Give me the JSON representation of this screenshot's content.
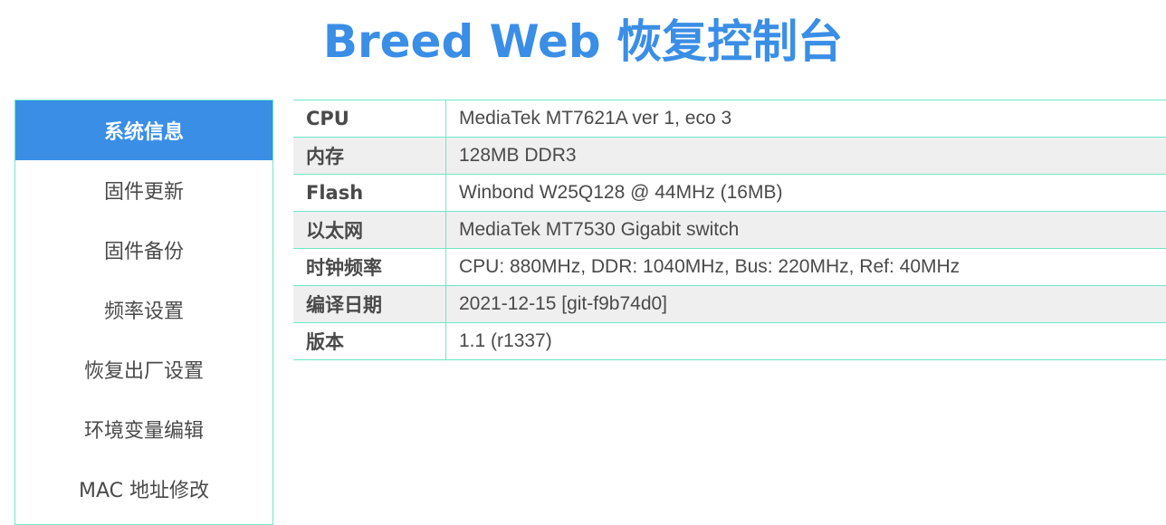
{
  "header": {
    "title": "Breed Web 恢复控制台"
  },
  "sidebar": {
    "items": [
      {
        "label": "系统信息",
        "active": true
      },
      {
        "label": "固件更新",
        "active": false
      },
      {
        "label": "固件备份",
        "active": false
      },
      {
        "label": "频率设置",
        "active": false
      },
      {
        "label": "恢复出厂设置",
        "active": false
      },
      {
        "label": "环境变量编辑",
        "active": false
      },
      {
        "label": "MAC 地址修改",
        "active": false
      }
    ]
  },
  "system_info": {
    "rows": [
      {
        "key": "CPU",
        "value": "MediaTek MT7621A ver 1, eco 3"
      },
      {
        "key": "内存",
        "value": "128MB DDR3"
      },
      {
        "key": "Flash",
        "value": "Winbond W25Q128 @ 44MHz (16MB)"
      },
      {
        "key": "以太网",
        "value": "MediaTek MT7530 Gigabit switch"
      },
      {
        "key": "时钟频率",
        "value": "CPU: 880MHz, DDR: 1040MHz, Bus: 220MHz, Ref: 40MHz"
      },
      {
        "key": "编译日期",
        "value": "2021-12-15 [git-f9b74d0]"
      },
      {
        "key": "版本",
        "value": "1.1 (r1337)"
      }
    ]
  },
  "colors": {
    "accent": "#3a8ee6",
    "border": "#6ee7c8",
    "row_alt": "#efefef",
    "text": "#4a4a4a"
  }
}
